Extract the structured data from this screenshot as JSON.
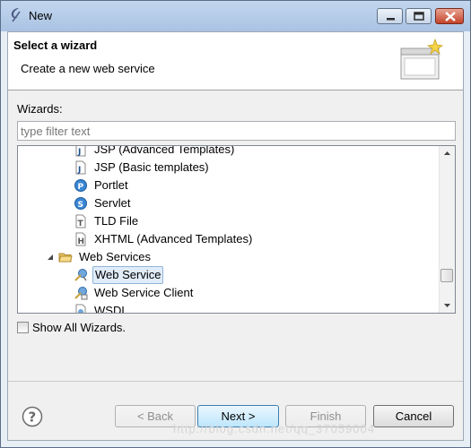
{
  "window": {
    "title": "New",
    "controls": [
      "minimize",
      "maximize",
      "close"
    ]
  },
  "banner": {
    "title": "Select a wizard",
    "description": "Create a new web service",
    "image_icon": "wizard-banner-icon"
  },
  "wizards": {
    "label": "Wizards:",
    "filter_placeholder": "type filter text",
    "filter_value": ""
  },
  "tree": {
    "items": [
      {
        "label": "JSP (Advanced Templates)",
        "icon": "jsp-file-icon",
        "selected": false
      },
      {
        "label": "JSP (Basic templates)",
        "icon": "jsp-file-icon",
        "selected": false
      },
      {
        "label": "Portlet",
        "icon": "portlet-icon",
        "selected": false
      },
      {
        "label": "Servlet",
        "icon": "servlet-icon",
        "selected": false
      },
      {
        "label": "TLD File",
        "icon": "tld-file-icon",
        "selected": false
      },
      {
        "label": "XHTML (Advanced Templates)",
        "icon": "xhtml-file-icon",
        "selected": false
      },
      {
        "label": "Web Services",
        "icon": "folder-open-icon",
        "expanded": true,
        "selected": false
      },
      {
        "label": "Web Service",
        "icon": "web-service-icon",
        "selected": true
      },
      {
        "label": "Web Service Client",
        "icon": "web-service-client-icon",
        "selected": false
      },
      {
        "label": "WSDL",
        "icon": "wsdl-file-icon",
        "selected": false
      }
    ]
  },
  "show_all": {
    "label": "Show All Wizards.",
    "checked": false
  },
  "buttons": {
    "back": "< Back",
    "next": "Next >",
    "finish": "Finish",
    "cancel": "Cancel"
  },
  "watermark": "http://blog.csdn.net/qq_37059004",
  "colors": {
    "titlebar": "#b8cde9",
    "selection": "#e0ecf8",
    "close_button": "#c4432a"
  }
}
